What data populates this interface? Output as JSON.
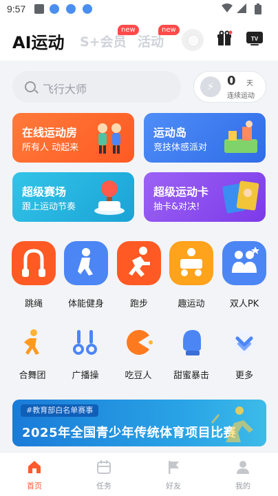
{
  "status_bar": {
    "time": "9:57"
  },
  "header": {
    "tabs": [
      {
        "label": "AI运动"
      },
      {
        "label": "S+会员",
        "badge": "new"
      },
      {
        "label": "活动",
        "badge": "new"
      }
    ]
  },
  "search": {
    "placeholder": "飞行大师"
  },
  "streak": {
    "count": "0",
    "unit": "天",
    "label": "连续运动"
  },
  "cards": [
    {
      "title": "在线运动房",
      "subtitle": "所有人 动起来",
      "color": "#ff6b2e"
    },
    {
      "title": "运动岛",
      "subtitle": "竞技体感派对",
      "color": "#3f7cf0"
    },
    {
      "title": "超级赛场",
      "subtitle": "跟上运动节奏",
      "color": "#22b3dc"
    },
    {
      "title": "超级运动卡",
      "subtitle": "抽卡&对决!",
      "color": "#8b4df0"
    }
  ],
  "primary_sports": [
    {
      "label": "跳绳",
      "icon": "jump-rope-icon",
      "color": "#ff5a23"
    },
    {
      "label": "体能健身",
      "icon": "fitness-icon",
      "color": "#4c86f5"
    },
    {
      "label": "跑步",
      "icon": "running-icon",
      "color": "#ff5a23"
    },
    {
      "label": "趣运动",
      "icon": "fun-sport-icon",
      "color": "#ffa21c"
    },
    {
      "label": "双人PK",
      "icon": "pk-icon",
      "color": "#4c86f5"
    }
  ],
  "secondary_sports": [
    {
      "label": "合舞团",
      "icon": "dance-icon"
    },
    {
      "label": "广播操",
      "icon": "broadcast-exercise-icon"
    },
    {
      "label": "吃豆人",
      "icon": "pacman-icon"
    },
    {
      "label": "甜蜜暴击",
      "icon": "boxing-glove-icon"
    },
    {
      "label": "更多",
      "icon": "more-icon"
    }
  ],
  "banner": {
    "tag": "#教育部白名单赛事",
    "title": "2025年全国青少年传统体育项目比赛"
  },
  "bottom_nav": [
    {
      "label": "首页",
      "icon": "home-icon",
      "active": true
    },
    {
      "label": "任务",
      "icon": "calendar-icon"
    },
    {
      "label": "好友",
      "icon": "flag-icon"
    },
    {
      "label": "我的",
      "icon": "profile-icon"
    }
  ]
}
